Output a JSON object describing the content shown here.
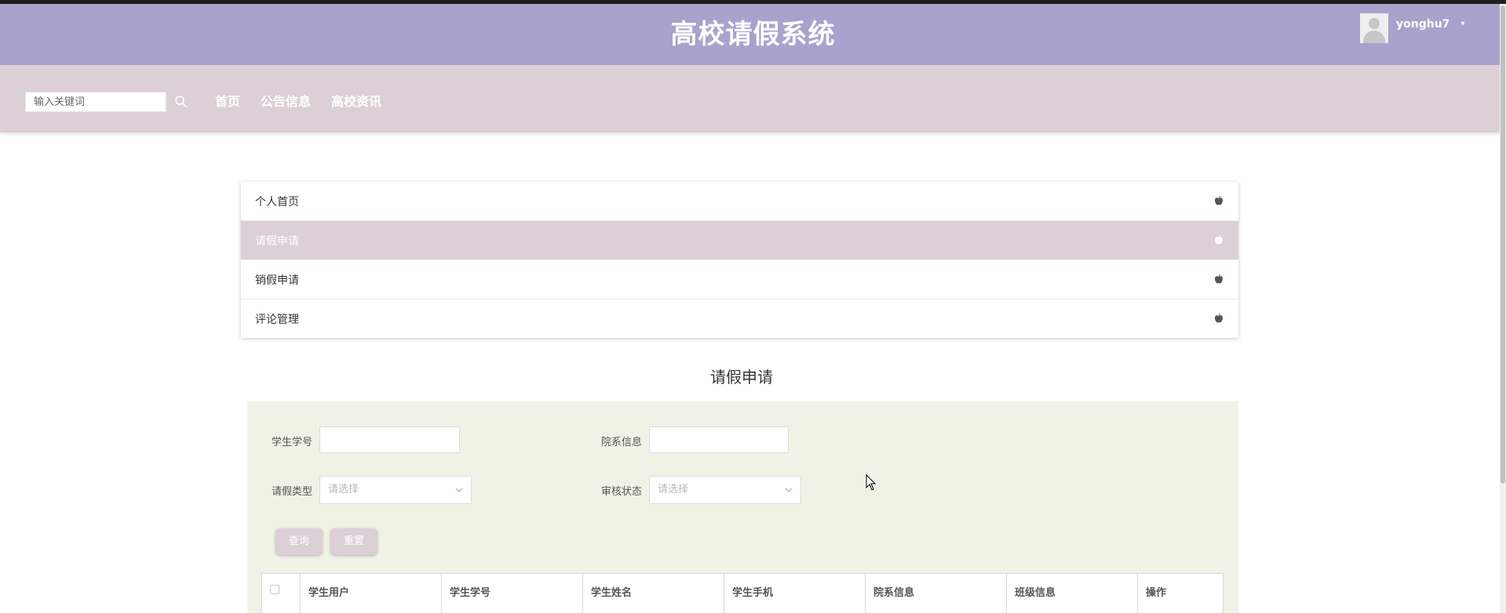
{
  "header": {
    "title": "高校请假系统",
    "user": {
      "name": "yonghu7",
      "caret": "▾"
    }
  },
  "navbar": {
    "search": {
      "placeholder": "输入关键词"
    },
    "links": [
      "首页",
      "公告信息",
      "高校资讯"
    ]
  },
  "menu": {
    "items": [
      {
        "label": "个人首页",
        "active": false
      },
      {
        "label": "请假申请",
        "active": true
      },
      {
        "label": "销假申请",
        "active": false
      },
      {
        "label": "评论管理",
        "active": false
      }
    ]
  },
  "page": {
    "title": "请假申请"
  },
  "filters": {
    "student_no_label": "学生学号",
    "dept_label": "院系信息",
    "leave_type_label": "请假类型",
    "leave_type_placeholder": "请选择",
    "audit_label": "审核状态",
    "audit_placeholder": "请选择",
    "query_btn": "查询",
    "reset_btn": "重置"
  },
  "table": {
    "columns": [
      "学生用户",
      "学生学号",
      "学生姓名",
      "学生手机",
      "院系信息",
      "班级信息",
      "操作"
    ]
  },
  "colors": {
    "header_bg": "#a8a2cc",
    "nav_bg": "#dccfd6",
    "panel_bg": "#eff2e5"
  }
}
